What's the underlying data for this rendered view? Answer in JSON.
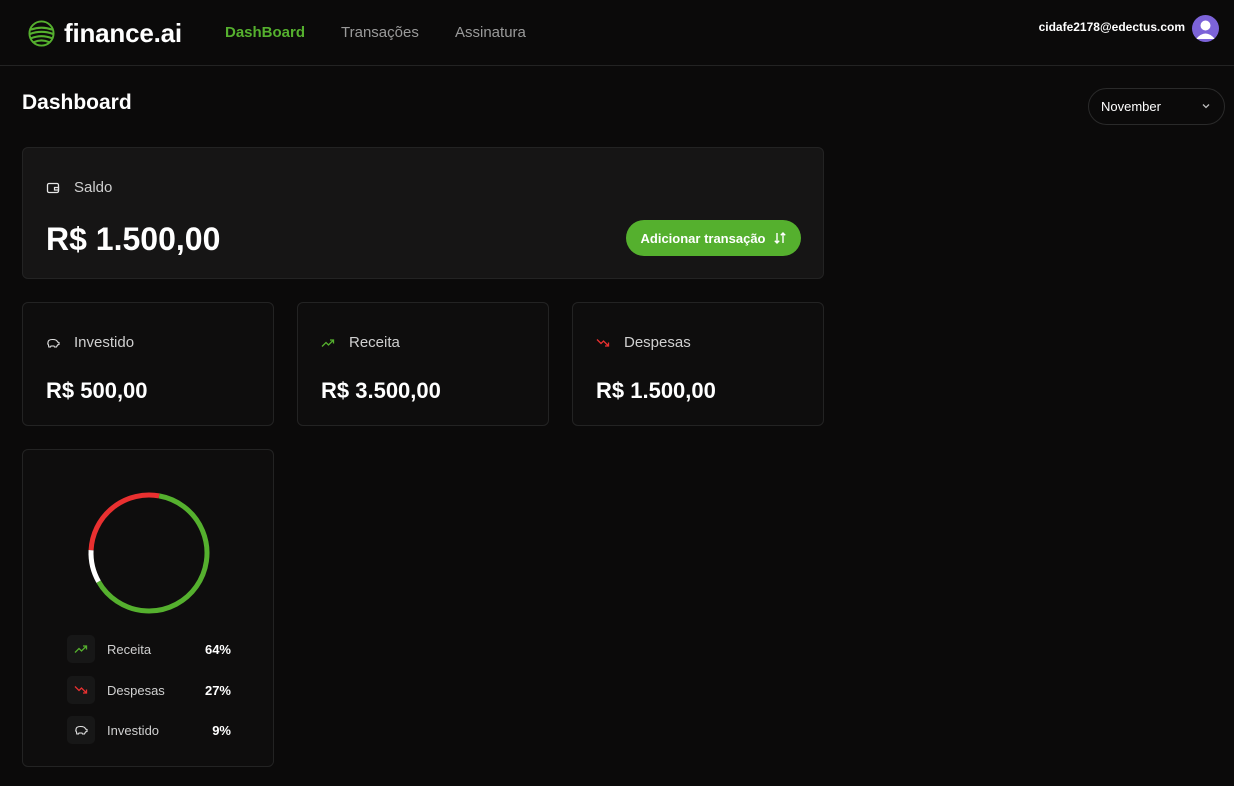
{
  "header": {
    "logo_text": "finance.ai",
    "nav": [
      "DashBoard",
      "Transações",
      "Assinatura"
    ],
    "user_email": "cidafe2178@edectus.com"
  },
  "page": {
    "title": "Dashboard",
    "month": "November"
  },
  "balance": {
    "label": "Saldo",
    "value": "R$ 1.500,00",
    "button_label": "Adicionar transação"
  },
  "summary": [
    {
      "label": "Investido",
      "value": "R$ 500,00",
      "icon": "piggy-bank-icon"
    },
    {
      "label": "Receita",
      "value": "R$ 3.500,00",
      "icon": "trending-up-icon"
    },
    {
      "label": "Despesas",
      "value": "R$ 1.500,00",
      "icon": "trending-down-icon"
    }
  ],
  "chart_data": {
    "type": "pie",
    "labels": [
      "Receita",
      "Despesas",
      "Investido"
    ],
    "values": [
      64,
      27,
      9
    ],
    "colors": [
      "#55b02e",
      "#e93030",
      "#ffffff"
    ]
  },
  "legend": [
    {
      "label": "Receita",
      "pct": "64%"
    },
    {
      "label": "Despesas",
      "pct": "27%"
    },
    {
      "label": "Investido",
      "pct": "9%"
    }
  ],
  "colors": {
    "accent": "#55b02e",
    "expense": "#e93030",
    "background": "#0b0a0a"
  }
}
